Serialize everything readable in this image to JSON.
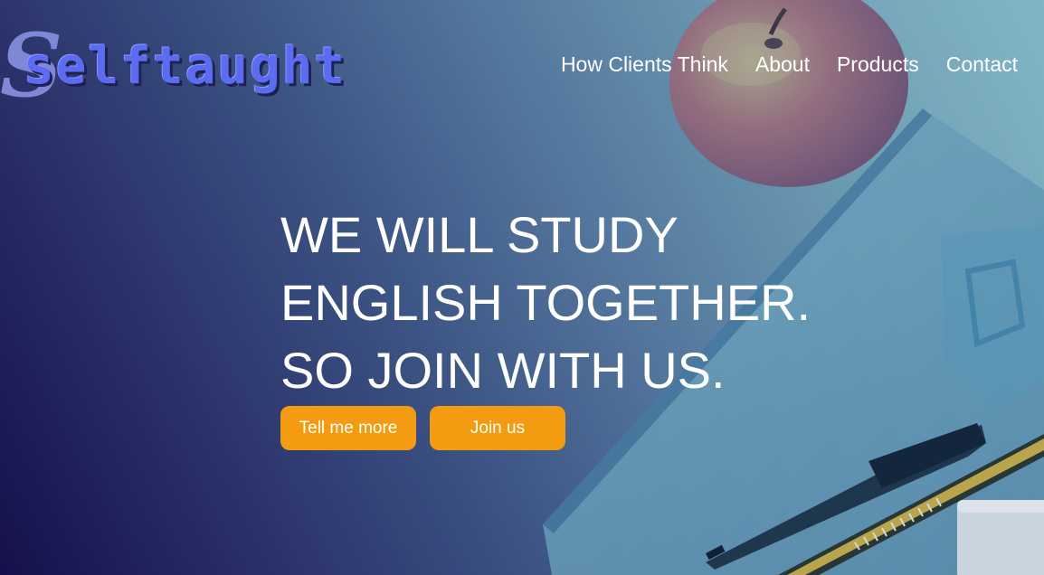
{
  "brand": {
    "initial": "S",
    "name": "selftaught"
  },
  "nav": {
    "items": [
      {
        "label": "How Clients Think"
      },
      {
        "label": "About"
      },
      {
        "label": "Products"
      },
      {
        "label": "Contact"
      }
    ]
  },
  "hero": {
    "headline_lines": [
      "WE WILL STUDY",
      "ENGLISH TOGETHER.",
      "SO JOIN WITH US."
    ],
    "buttons": {
      "more_label": "Tell me more",
      "join_label": "Join us"
    }
  },
  "colors": {
    "button_bg": "#f39c12",
    "logo_text": "#5c6cf0",
    "gradient_dark": "#14104a",
    "gradient_light": "#8bc3cd"
  },
  "icons": [
    "apple-image",
    "notebook-image",
    "pen-image",
    "pencil-image",
    "eraser-image"
  ]
}
